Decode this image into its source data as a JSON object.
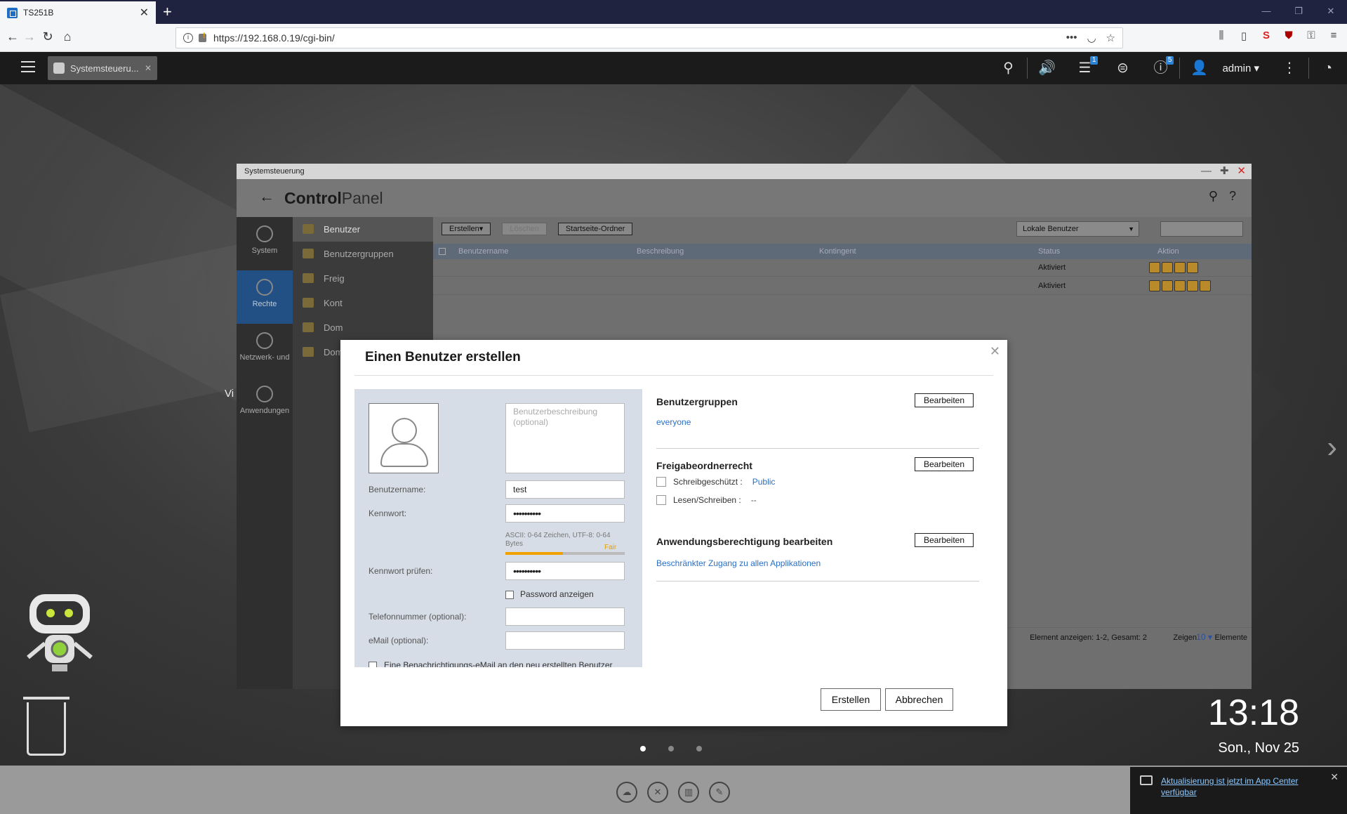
{
  "browser": {
    "tab_title": "TS251B",
    "url": "https://192.168.0.19/cgi-bin/"
  },
  "qts": {
    "app_tab": "Systemsteueru...",
    "user": "admin",
    "badges": {
      "tasks": "1",
      "info": "5"
    }
  },
  "desktop": {
    "clock": "13:18",
    "date": "Son., Nov 25",
    "side_text": "Vi",
    "notification": "Aktualisierung ist jetzt im App Center verfügbar"
  },
  "controlpanel": {
    "window_title": "Systemsteuerung",
    "logo_bold": "Control",
    "logo_light": "Panel",
    "nav": [
      "System",
      "Rechte",
      "Netzwerk- und",
      "Anwendungen"
    ],
    "sub": [
      "Benutzer",
      "Benutzergruppen",
      "Freig",
      "Kont",
      "Dom",
      "Dom"
    ],
    "toolbar": {
      "create": "Erstellen▾",
      "delete": "Löschen",
      "home": "Startseite-Ordner"
    },
    "filter": "Lokale Benutzer",
    "columns": [
      "Benutzername",
      "Beschreibung",
      "Kontingent",
      "Status",
      "Aktion"
    ],
    "rows": [
      {
        "status": "Aktiviert"
      },
      {
        "status": "Aktiviert"
      }
    ],
    "footer": {
      "items": "Element anzeigen: 1-2, Gesamt: 2",
      "show": "Zeigen",
      "count": "10",
      "unit": "Elemente"
    }
  },
  "dialog": {
    "title": "Einen Benutzer erstellen",
    "desc_placeholder": "Benutzerbeschreibung (optional)",
    "username_label": "Benutzername:",
    "username_value": "test",
    "password_label": "Kennwort:",
    "password_value": "••••••••••",
    "password_hint": "ASCII: 0-64 Zeichen, UTF-8: 0-64 Bytes",
    "strength_label": "Fair",
    "strength_value": 0.48,
    "confirm_label": "Kennwort prüfen:",
    "confirm_value": "••••••••••",
    "show_password": "Password anzeigen",
    "phone_label": "Telefonnummer (optional):",
    "email_label": "eMail (optional):",
    "notify_label": "Eine Benachrichtigungs-eMail an den neu erstellten Benutzer",
    "groups_title": "Benutzergruppen",
    "groups_value": "everyone",
    "share_title": "Freigabeordnerrecht",
    "readonly_label": "Schreibgeschützt :",
    "readonly_value": "Public",
    "readwrite_label": "Lesen/Schreiben :",
    "readwrite_value": "--",
    "app_title": "Anwendungsberechtigung bearbeiten",
    "app_value": "Beschränkter Zugang zu allen Applikationen",
    "edit": "Bearbeiten",
    "create": "Erstellen",
    "cancel": "Abbrechen"
  }
}
